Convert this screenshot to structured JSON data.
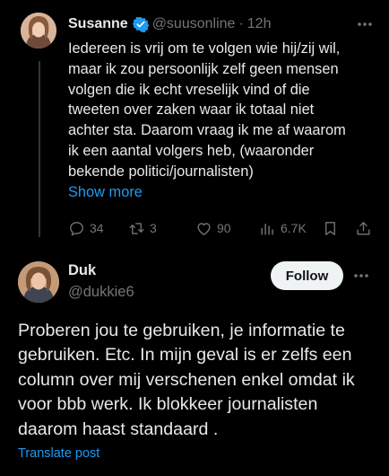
{
  "tweet1": {
    "name": "Susanne",
    "handle": "@suusonline",
    "separator": "·",
    "time": "12h",
    "body": "Iedereen is vrij om te volgen wie hij/zij wil,\nmaar ik zou persoonlijk zelf geen mensen\nvolgen die ik echt vreselijk vind of die\ntweeten over zaken waar ik totaal niet\nachter sta. Daarom vraag ik me af waarom\nik een aantal volgers heb, (waaronder\nbekende politici/journalisten)",
    "show_more": "Show more",
    "replies": "34",
    "reposts": "3",
    "likes": "90",
    "views": "6.7K",
    "verified_color": "#1d9bf0"
  },
  "tweet2": {
    "name": "Duk",
    "handle": "@dukkie6",
    "follow_label": "Follow",
    "body": "Proberen jou te gebruiken, je informatie te\ngebruiken. Etc. In mijn geval is er zelfs een\ncolumn over mij verschenen enkel omdat ik\nvoor bbb werk. Ik blokkeer journalisten\ndaarom haast standaard .",
    "translate": "Translate post"
  },
  "colors": {
    "background": "#000000",
    "text": "#e7e9ea",
    "secondary": "#71767b",
    "accent": "#1d9bf0"
  },
  "icons": [
    "verified-badge-icon",
    "more-icon",
    "reply-icon",
    "repost-icon",
    "like-icon",
    "views-icon",
    "bookmark-icon",
    "share-icon"
  ]
}
